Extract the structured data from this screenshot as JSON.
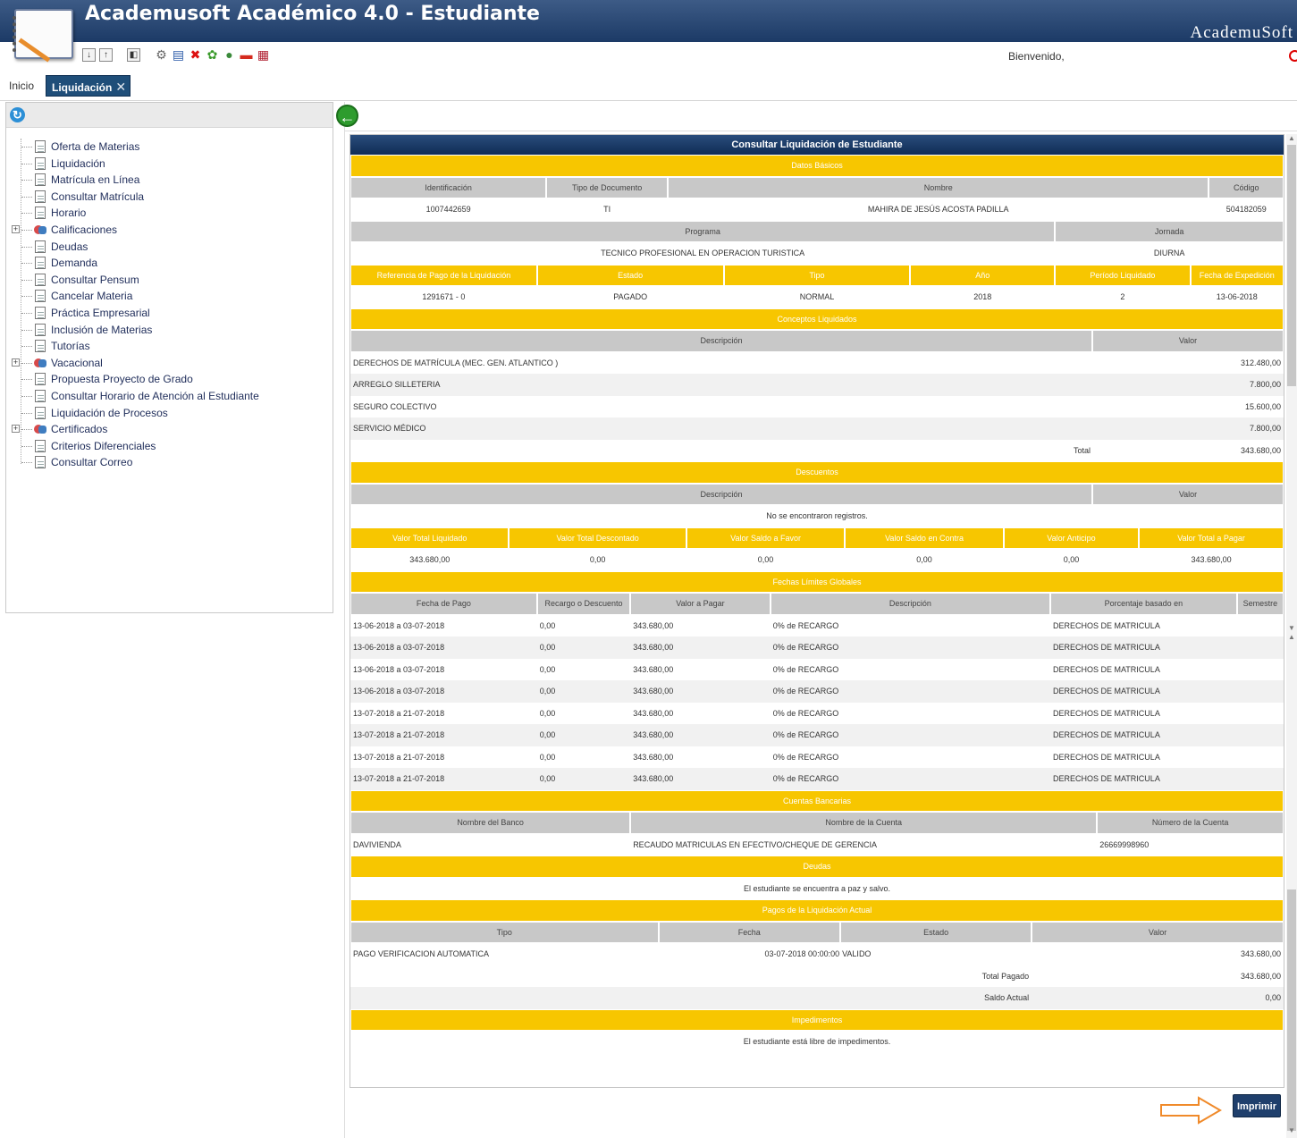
{
  "app": {
    "title": "Academusoft Académico 4.0 - Estudiante",
    "brand": "AcademuSoft",
    "welcome": "Bienvenido,"
  },
  "tabs": [
    {
      "label": "Inicio"
    },
    {
      "label": "Liquidación",
      "close": "✕"
    }
  ],
  "menu": [
    {
      "label": "Oferta de Materias",
      "type": "doc"
    },
    {
      "label": "Liquidación",
      "type": "doc"
    },
    {
      "label": "Matrícula en Línea",
      "type": "doc"
    },
    {
      "label": "Consultar Matrícula",
      "type": "doc"
    },
    {
      "label": "Horario",
      "type": "doc"
    },
    {
      "label": "Calificaciones",
      "type": "folder"
    },
    {
      "label": "Deudas",
      "type": "doc"
    },
    {
      "label": "Demanda",
      "type": "doc"
    },
    {
      "label": "Consultar Pensum",
      "type": "doc"
    },
    {
      "label": "Cancelar Materia",
      "type": "doc"
    },
    {
      "label": "Práctica Empresarial",
      "type": "doc"
    },
    {
      "label": "Inclusión de Materias",
      "type": "doc"
    },
    {
      "label": "Tutorías",
      "type": "doc"
    },
    {
      "label": "Vacacional",
      "type": "folder"
    },
    {
      "label": "Propuesta Proyecto de Grado",
      "type": "doc"
    },
    {
      "label": "Consultar Horario de Atención al Estudiante",
      "type": "doc"
    },
    {
      "label": "Liquidación de Procesos",
      "type": "doc"
    },
    {
      "label": "Certificados",
      "type": "folder"
    },
    {
      "label": "Criterios Diferenciales",
      "type": "doc"
    },
    {
      "label": "Consultar Correo",
      "type": "doc"
    }
  ],
  "report": {
    "title": "Consultar Liquidación de Estudiante",
    "datos_basicos": {
      "section": "Datos Básicos",
      "headers": [
        "Identificación",
        "Tipo de Documento",
        "Nombre",
        "Código"
      ],
      "values": [
        "1007442659",
        "TI",
        "MAHIRA DE JESÚS ACOSTA PADILLA",
        "504182059"
      ],
      "headers2": [
        "Programa",
        "Jornada"
      ],
      "values2": [
        "TECNICO PROFESIONAL EN OPERACION TURISTICA",
        "DIURNA"
      ],
      "headers3": [
        "Referencia de Pago de la Liquidación",
        "Estado",
        "Tipo",
        "Año",
        "Período Liquidado",
        "Fecha de Expedición"
      ],
      "values3": [
        "1291671 - 0",
        "PAGADO",
        "NORMAL",
        "2018",
        "2",
        "13-06-2018"
      ]
    },
    "conceptos": {
      "section": "Conceptos Liquidados",
      "headers": [
        "Descripción",
        "Valor"
      ],
      "rows": [
        [
          "DERECHOS DE MATRÍCULA  (MEC. GEN. ATLANTICO )",
          "312.480,00"
        ],
        [
          "ARREGLO SILLETERIA",
          "7.800,00"
        ],
        [
          "SEGURO COLECTIVO",
          "15.600,00"
        ],
        [
          "SERVICIO MÉDICO",
          "7.800,00"
        ]
      ],
      "total_label": "Total",
      "total": "343.680,00"
    },
    "descuentos": {
      "section": "Descuentos",
      "headers": [
        "Descripción",
        "Valor"
      ],
      "empty": "No se encontraron registros."
    },
    "totales": {
      "headers": [
        "Valor Total Liquidado",
        "Valor Total Descontado",
        "Valor Saldo a Favor",
        "Valor Saldo en Contra",
        "Valor Anticipo",
        "Valor Total a Pagar"
      ],
      "values": [
        "343.680,00",
        "0,00",
        "0,00",
        "0,00",
        "0,00",
        "343.680,00"
      ]
    },
    "fechas": {
      "section": "Fechas Límites Globales",
      "headers": [
        "Fecha de Pago",
        "Recargo o Descuento",
        "Valor a Pagar",
        "Descripción",
        "Porcentaje basado en",
        "Semestre"
      ],
      "rows": [
        [
          "13-06-2018 a 03-07-2018",
          "0,00",
          "343.680,00",
          "0% de RECARGO",
          "DERECHOS DE MATRICULA",
          ""
        ],
        [
          "13-06-2018 a 03-07-2018",
          "0,00",
          "343.680,00",
          "0% de RECARGO",
          "DERECHOS DE MATRICULA",
          ""
        ],
        [
          "13-06-2018 a 03-07-2018",
          "0,00",
          "343.680,00",
          "0% de RECARGO",
          "DERECHOS DE MATRICULA",
          ""
        ],
        [
          "13-06-2018 a 03-07-2018",
          "0,00",
          "343.680,00",
          "0% de RECARGO",
          "DERECHOS DE MATRICULA",
          ""
        ],
        [
          "13-07-2018 a 21-07-2018",
          "0,00",
          "343.680,00",
          "0% de RECARGO",
          "DERECHOS DE MATRICULA",
          ""
        ],
        [
          "13-07-2018 a 21-07-2018",
          "0,00",
          "343.680,00",
          "0% de RECARGO",
          "DERECHOS DE MATRICULA",
          ""
        ],
        [
          "13-07-2018 a 21-07-2018",
          "0,00",
          "343.680,00",
          "0% de RECARGO",
          "DERECHOS DE MATRICULA",
          ""
        ],
        [
          "13-07-2018 a 21-07-2018",
          "0,00",
          "343.680,00",
          "0% de RECARGO",
          "DERECHOS DE MATRICULA",
          ""
        ]
      ]
    },
    "cuentas": {
      "section": "Cuentas Bancarias",
      "headers": [
        "Nombre del Banco",
        "Nombre de la Cuenta",
        "Número de la Cuenta"
      ],
      "rows": [
        [
          "DAVIVIENDA",
          "RECAUDO MATRICULAS EN EFECTIVO/CHEQUE DE GERENCIA",
          "26669998960"
        ]
      ]
    },
    "deudas": {
      "section": "Deudas",
      "text": "El estudiante se encuentra a paz y salvo."
    },
    "pagos": {
      "section": "Pagos de la Liquidación Actual",
      "headers": [
        "Tipo",
        "Fecha",
        "Estado",
        "Valor"
      ],
      "rows": [
        [
          "PAGO VERIFICACION AUTOMATICA",
          "03-07-2018 00:00:00",
          "VALIDO",
          "343.680,00"
        ]
      ],
      "total_pagado_label": "Total Pagado",
      "total_pagado": "343.680,00",
      "saldo_label": "Saldo Actual",
      "saldo": "0,00"
    },
    "impedimentos": {
      "section": "Impedimentos",
      "text": "El estudiante está libre de impedimentos."
    }
  },
  "print_button": "Imprimir",
  "colors": {
    "header": "#1c3a66",
    "section": "#f7c600",
    "print": "#1f3f6c",
    "arrow": "#f08a2a"
  }
}
